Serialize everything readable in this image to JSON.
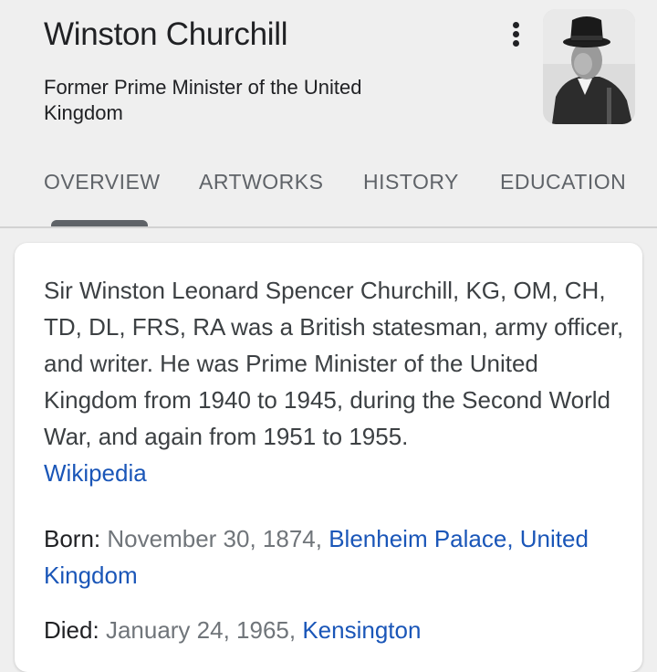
{
  "header": {
    "title": "Winston Churchill",
    "subtitle": "Former Prime Minister of the United Kingdom",
    "more_icon": "more-vert-icon",
    "image": "winston-churchill-portrait"
  },
  "tabs": [
    {
      "label": "OVERVIEW",
      "selected": true
    },
    {
      "label": "ARTWORKS",
      "selected": false
    },
    {
      "label": "HISTORY",
      "selected": false
    },
    {
      "label": "EDUCATION",
      "selected": false
    }
  ],
  "card": {
    "description": "Sir Winston Leonard Spencer Churchill, KG, OM, CH, TD, DL, FRS, RA was a British statesman, army officer, and writer. He was Prime Minister of the United Kingdom from 1940 to 1945, during the Second World War, and again from 1951 to 1955.",
    "source_link": "Wikipedia",
    "born": {
      "label": "Born:",
      "value": "November 30, 1874,",
      "place_link": "Blenheim Palace, United Kingdom"
    },
    "died": {
      "label": "Died:",
      "value": "January 24, 1965,",
      "place_link": "Kensington"
    }
  },
  "colors": {
    "background": "#efefef",
    "card": "#ffffff",
    "link": "#1a56b8",
    "tab_text": "#5f6368",
    "muted_value": "#70757a"
  }
}
